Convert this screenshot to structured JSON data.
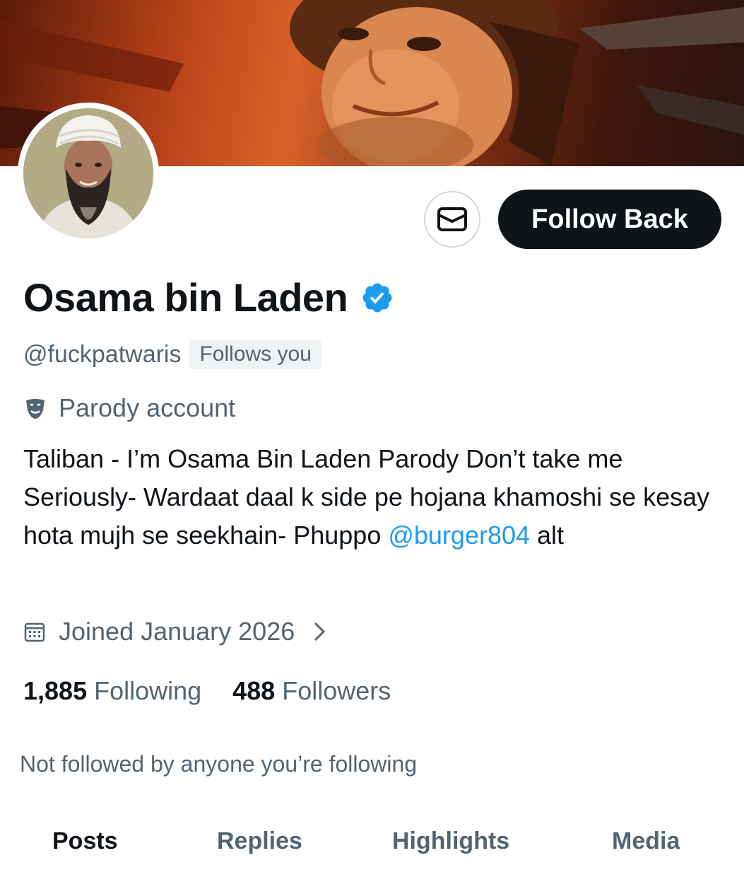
{
  "profile": {
    "display_name": "Osama bin Laden",
    "handle": "@fuckpatwaris",
    "follows_you_label": "Follows you",
    "account_label": "Parody account",
    "bio_text": "Taliban - I’m Osama Bin Laden Parody Don’t take me Seriously- Wardaat daal k side pe hojana khamoshi se kesay hota mujh se seekhain- Phuppo ",
    "bio_mention": "@burger804",
    "bio_suffix": " alt",
    "joined": "Joined January 2026",
    "following_count": "1,885",
    "following_label": "Following",
    "followers_count": "488",
    "followers_label": "Followers",
    "not_followed_text": "Not followed by anyone you’re following"
  },
  "actions": {
    "follow_back_label": "Follow Back",
    "message_icon": "envelope-icon"
  },
  "tabs": [
    {
      "label": "Posts",
      "active": true
    },
    {
      "label": "Replies",
      "active": false
    },
    {
      "label": "Highlights",
      "active": false
    },
    {
      "label": "Media",
      "active": false
    }
  ],
  "colors": {
    "link": "#1d9bf0",
    "secondary_text": "#536471",
    "primary_text": "#0f1419",
    "verified": "#1d9bf0"
  }
}
